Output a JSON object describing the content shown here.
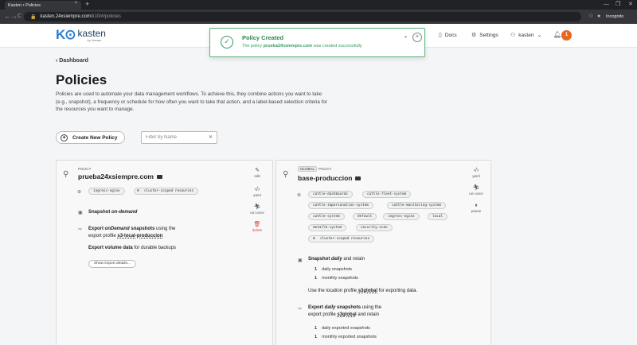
{
  "browser": {
    "tab_title": "Kasten • Policies",
    "tab_close": "×",
    "new_tab": "+",
    "url_host": "kasten.24xsiempre.com",
    "url_path": "/k10/#/policies",
    "profile": "Incognito",
    "minimize": "—",
    "restore": "❐",
    "close": "✕",
    "back": "←",
    "forward": "→",
    "reload": "C",
    "star": "☆"
  },
  "header": {
    "logo_mark": "K⊙",
    "logo_name": "kasten",
    "logo_sub": "by Veeam",
    "docs_label": "Docs",
    "settings_label": "Settings",
    "user_label": "kasten",
    "notification_count": "1"
  },
  "toast": {
    "title": "Policy Created",
    "msg_prefix": "The policy ",
    "msg_name": "prueba24xsiempre.com",
    "msg_suffix": " was created successfully.",
    "pause": "⏸",
    "close": "×"
  },
  "page": {
    "breadcrumb": "Dashboard",
    "title": "Policies",
    "description": "Policies are used to automate your data management workflows. To achieve this, they combine actions you want to take (e.g., snapshot), a frequency or schedule for how often you want to take that action, and a label-based selection criteria for the resources you want to manage.",
    "create_label": "Create New Policy",
    "filter_placeholder": "Filter by Name"
  },
  "card1": {
    "label": "POLICY",
    "name": "prueba24xsiempre.com",
    "tags": [
      "ingress-nginx",
      "cluster-scoped resources"
    ],
    "snapshot_pre": "Snapshot ",
    "snapshot_freq": "on-demand",
    "export_pre": "Export ",
    "export_freq": "onDemand",
    "export_mid": " snapshots",
    "export_using": " using the",
    "export_profile_pre": "export profile ",
    "export_profile": "s3-local-produccion",
    "volume_bold": "Export volume data",
    "volume_rest": " for durable backups",
    "import_btn": "Show import details...",
    "actions": {
      "edit": "edit",
      "yaml": "yaml",
      "run": "run once",
      "delete": "delete"
    }
  },
  "card2": {
    "global_tag": "GLOBAL",
    "label": "POLICY",
    "name": "base-produccion",
    "tags": [
      "cattle-dashboards",
      "cattle-fleet-system",
      "cattle-impersonation-system",
      "cattle-monitoring-system",
      "cattle-system",
      "default",
      "ingress-nginx",
      "local",
      "metallb-system",
      "security-scan",
      "cluster-scoped resources"
    ],
    "snapshot_pre": "Snapshot ",
    "snapshot_freq": "daily",
    "snapshot_post": " and retain",
    "counts": [
      {
        "n": "1",
        "label": "daily snapshots"
      },
      {
        "n": "1",
        "label": "monthly snapshots"
      }
    ],
    "location_pre": "Use the location profile ",
    "location_profile": "s3global",
    "location_post": " for exporting data.",
    "export_pre": "Export ",
    "export_freq": "daily",
    "export_mid": " snapshots",
    "export_using": " using the",
    "export_profile_pre": "export profile ",
    "export_profile": "s3global",
    "export_post": " and retain",
    "export_counts": [
      {
        "n": "1",
        "label": "daily exported snapshots"
      },
      {
        "n": "1",
        "label": "monthly exported snapshots"
      }
    ],
    "actions": {
      "yaml": "yaml",
      "run": "run once",
      "pause": "pause"
    }
  }
}
